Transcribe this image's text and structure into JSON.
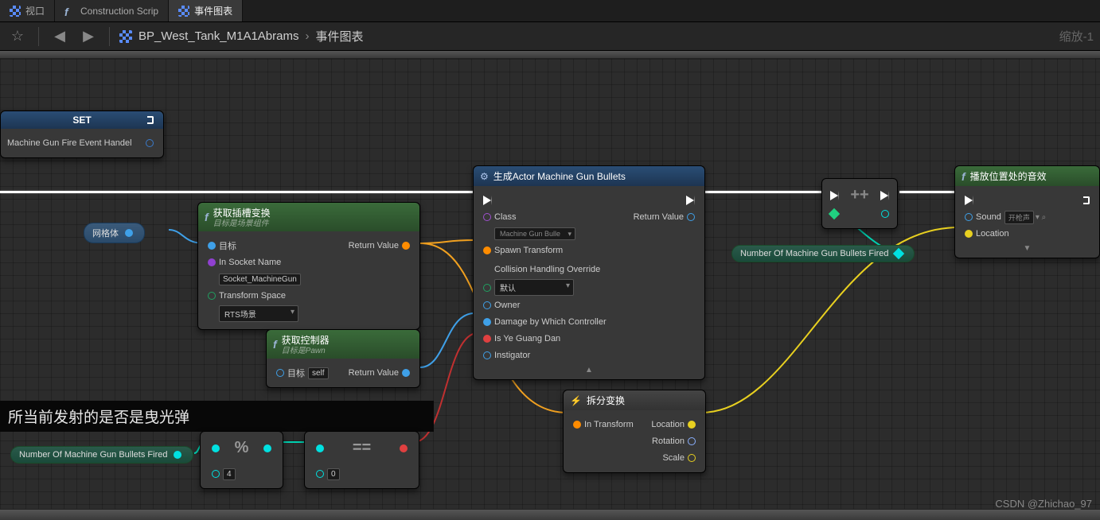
{
  "tabs": {
    "t1": "视口",
    "t2": "Construction Scrip",
    "t3": "事件图表"
  },
  "toolbar": {
    "breadcrumb_main": "BP_West_Tank_M1A1Abrams",
    "breadcrumb_sub": "事件图表",
    "zoom": "缩放-1"
  },
  "set_node": {
    "title": "SET",
    "pin_label": "Machine Gun Fire Event Handel"
  },
  "mesh_var": {
    "label": "网格体"
  },
  "socket_node": {
    "title": "获取插槽变换",
    "subtitle": "目标是场景组件",
    "target": "目标",
    "in_socket": "In Socket Name",
    "socket_value": "Socket_MachineGun",
    "transform_space": "Transform Space",
    "ts_value": "RTS场景",
    "return": "Return Value"
  },
  "controller_node": {
    "title": "获取控制器",
    "subtitle": "目标是Pawn",
    "target": "目标",
    "self": "self",
    "return": "Return Value"
  },
  "spawn_node": {
    "title": "生成Actor Machine Gun Bullets",
    "class": "Class",
    "class_value": "Machine Gun Bulle",
    "spawn_transform": "Spawn Transform",
    "collision": "Collision Handling Override",
    "collision_value": "默认",
    "owner": "Owner",
    "damage_ctrl": "Damage by Which Controller",
    "yeguang": "Is Ye Guang Dan",
    "instigator": "Instigator",
    "return": "Return Value"
  },
  "break_node": {
    "title": "拆分变换",
    "in_transform": "In Transform",
    "location": "Location",
    "rotation": "Rotation",
    "scale": "Scale"
  },
  "sound_node": {
    "title": "播放位置处的音效",
    "sound": "Sound",
    "sound_value": "开枪声",
    "location": "Location"
  },
  "bullets_var": {
    "label": "Number Of Machine Gun Bullets Fired"
  },
  "comment": "所当前发射的是否是曳光弹",
  "mod": {
    "input_a": "4",
    "input_b": "0"
  },
  "watermark": "CSDN @Zhichao_97"
}
